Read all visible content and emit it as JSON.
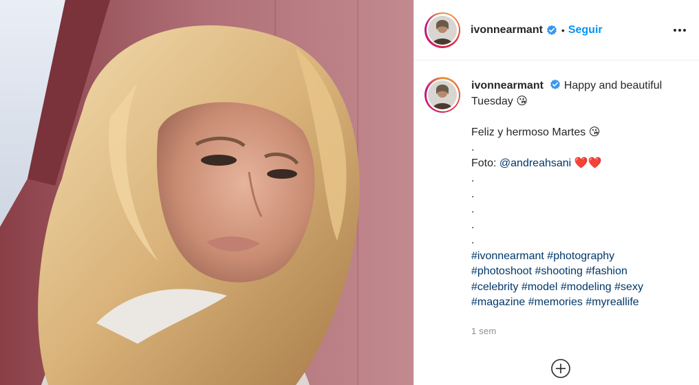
{
  "post": {
    "username": "ivonnearmant",
    "separator": "•",
    "follow_label": "Seguir",
    "more_icon": "more-options-icon",
    "verified_icon": "verified-badge-icon",
    "caption": {
      "username": "ivonnearmant",
      "intro": "Happy and beautiful Tuesday 😘",
      "spanish": "Feliz y hermoso Martes 😘",
      "dot": ".",
      "photo_prefix": "Foto: ",
      "photo_mention": "@andreahsani",
      "photo_suffix": " ❤️❤️",
      "hashtags": [
        "#ivonnearmant",
        "#photography",
        "#photoshoot",
        "#shooting",
        "#fashion",
        "#celebrity",
        "#model",
        "#modeling",
        "#sexy",
        "#magazine",
        "#memories",
        "#myreallife"
      ]
    },
    "timestamp": "1 sem",
    "load_more_icon": "add-circle-icon"
  },
  "colors": {
    "link_blue": "#0095f6",
    "hashtag_blue": "#00376b",
    "muted_gray": "#8e8e8e",
    "verified_blue": "#3897f0"
  }
}
